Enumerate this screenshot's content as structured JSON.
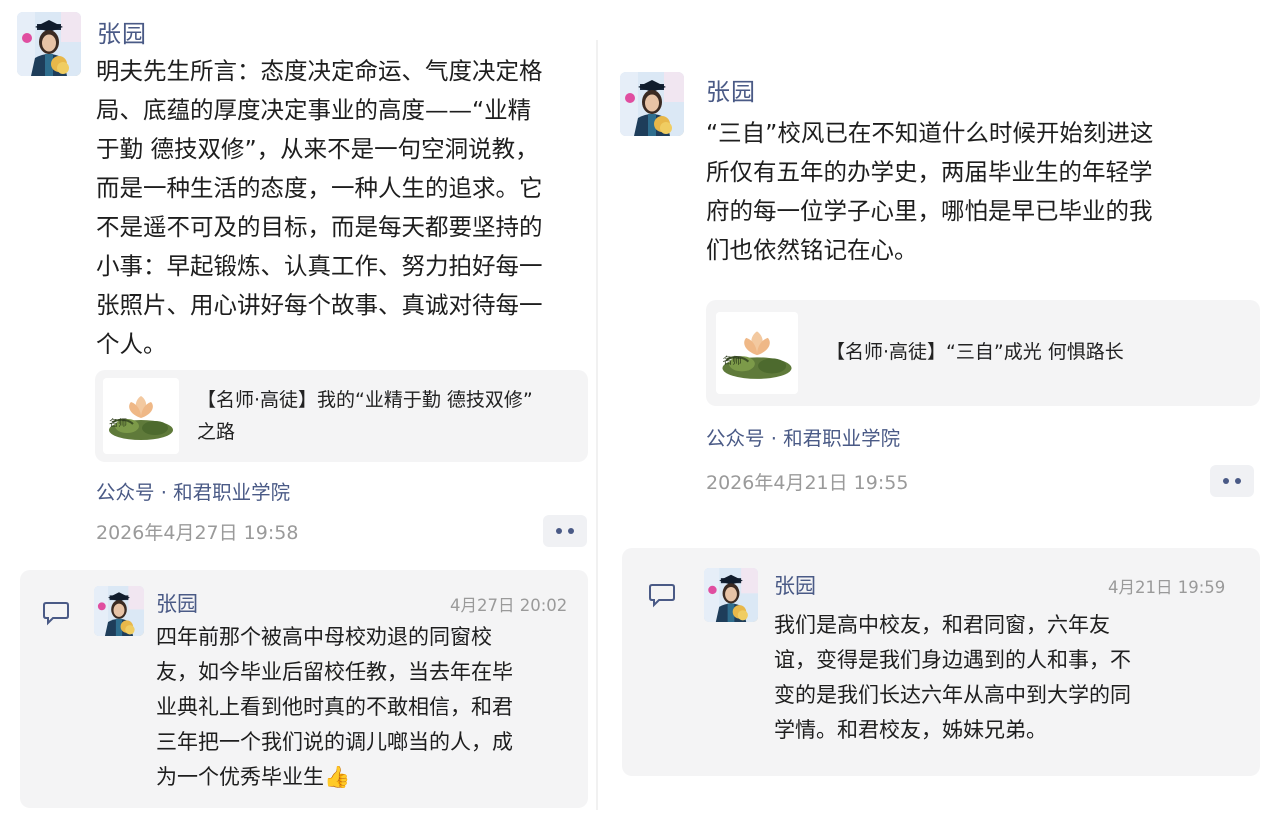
{
  "left_post": {
    "author": "张园",
    "body_lines": [
      "明夫先生所言：态度决定命运、气度决定格",
      "局、底蕴的厚度决定事业的高度——“业精",
      "于勤 德技双修”，从来不是一句空洞说教，",
      "而是一种生活的态度，一种人生的追求。它",
      "不是遥不可及的目标，而是每天都要坚持的",
      "小事：早起锻炼、认真工作、努力拍好每一",
      "张照片、用心讲好每个故事、真诚对待每一",
      "个人。"
    ],
    "card_lines": [
      "【名师·高徒】我的“业精于勤 德技双修”",
      "之路"
    ],
    "source": "公众号 · 和君职业学院",
    "time": "2026年4月27日 19:58",
    "comment": {
      "author": "张园",
      "time": "4月27日 20:02",
      "lines": [
        "四年前那个被高中母校劝退的同窗校",
        "友，如今毕业后留校任教，当去年在毕",
        "业典礼上看到他时真的不敢相信，和君",
        "三年把一个我们说的调儿啷当的人，成",
        "为一个优秀毕业生"
      ],
      "emoji": "👍"
    }
  },
  "right_post": {
    "author": "张园",
    "body_lines": [
      "“三自”校风已在不知道什么时候开始刻进这",
      "所仅有五年的办学史，两届毕业生的年轻学",
      "府的每一位学子心里，哪怕是早已毕业的我",
      "们也依然铭记在心。"
    ],
    "card_lines": [
      "【名师·高徒】“三自”成光  何惧路长"
    ],
    "source": "公众号 · 和君职业学院",
    "time": "2026年4月21日 19:55",
    "comment": {
      "author": "张园",
      "time": "4月21日 19:59",
      "lines": [
        "我们是高中校友，和君同窗，六年友",
        "谊，变得是我们身边遇到的人和事，不",
        "变的是我们长达六年从高中到大学的同",
        "学情。和君校友，姊妹兄弟。"
      ]
    }
  },
  "icons": {
    "more": "more-dots-icon",
    "comment": "comment-bubble-icon",
    "avatar": "user-avatar-photo",
    "thumb": "lotus-thumbnail"
  },
  "colors": {
    "accent": "#4a5a86",
    "card_bg": "#f4f4f5",
    "muted": "#9a9a9a"
  }
}
